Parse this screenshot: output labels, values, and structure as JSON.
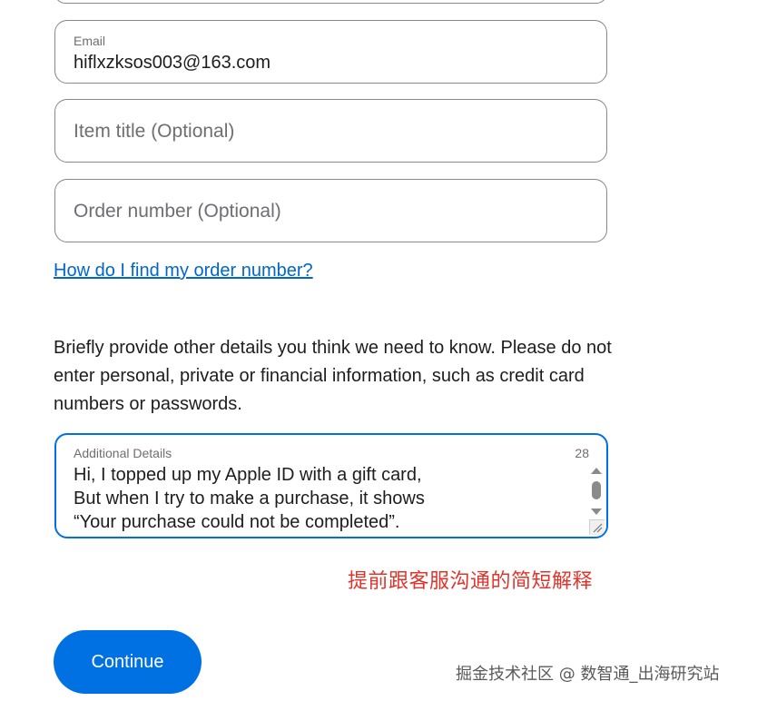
{
  "form": {
    "email": {
      "label": "Email",
      "value": "hiflxzksos003@163.com"
    },
    "item_title": {
      "placeholder": "Item title (Optional)"
    },
    "order_number": {
      "placeholder": "Order number (Optional)"
    },
    "help_link": "How do I find my order number?",
    "instructions": "Briefly provide other details you think we need to know. Please do not enter personal, private or financial information, such as credit card numbers or passwords.",
    "details": {
      "label": "Additional Details",
      "counter": "28",
      "value": "Hi, I topped up my Apple ID with a gift card,\nBut when I try to make a purchase, it shows\n“Your purchase could not be completed”."
    },
    "continue_label": "Continue"
  },
  "annotation": "提前跟客服沟通的简短解释",
  "watermark": "掘金技术社区 @ 数智通_出海研究站",
  "colors": {
    "accent": "#0071e3",
    "link": "#0066cc",
    "annotation": "#e0342b",
    "border": "#86868b"
  },
  "icons": {
    "scroll_up": "triangle-up",
    "scroll_down": "triangle-down",
    "resize": "resize-grip"
  }
}
